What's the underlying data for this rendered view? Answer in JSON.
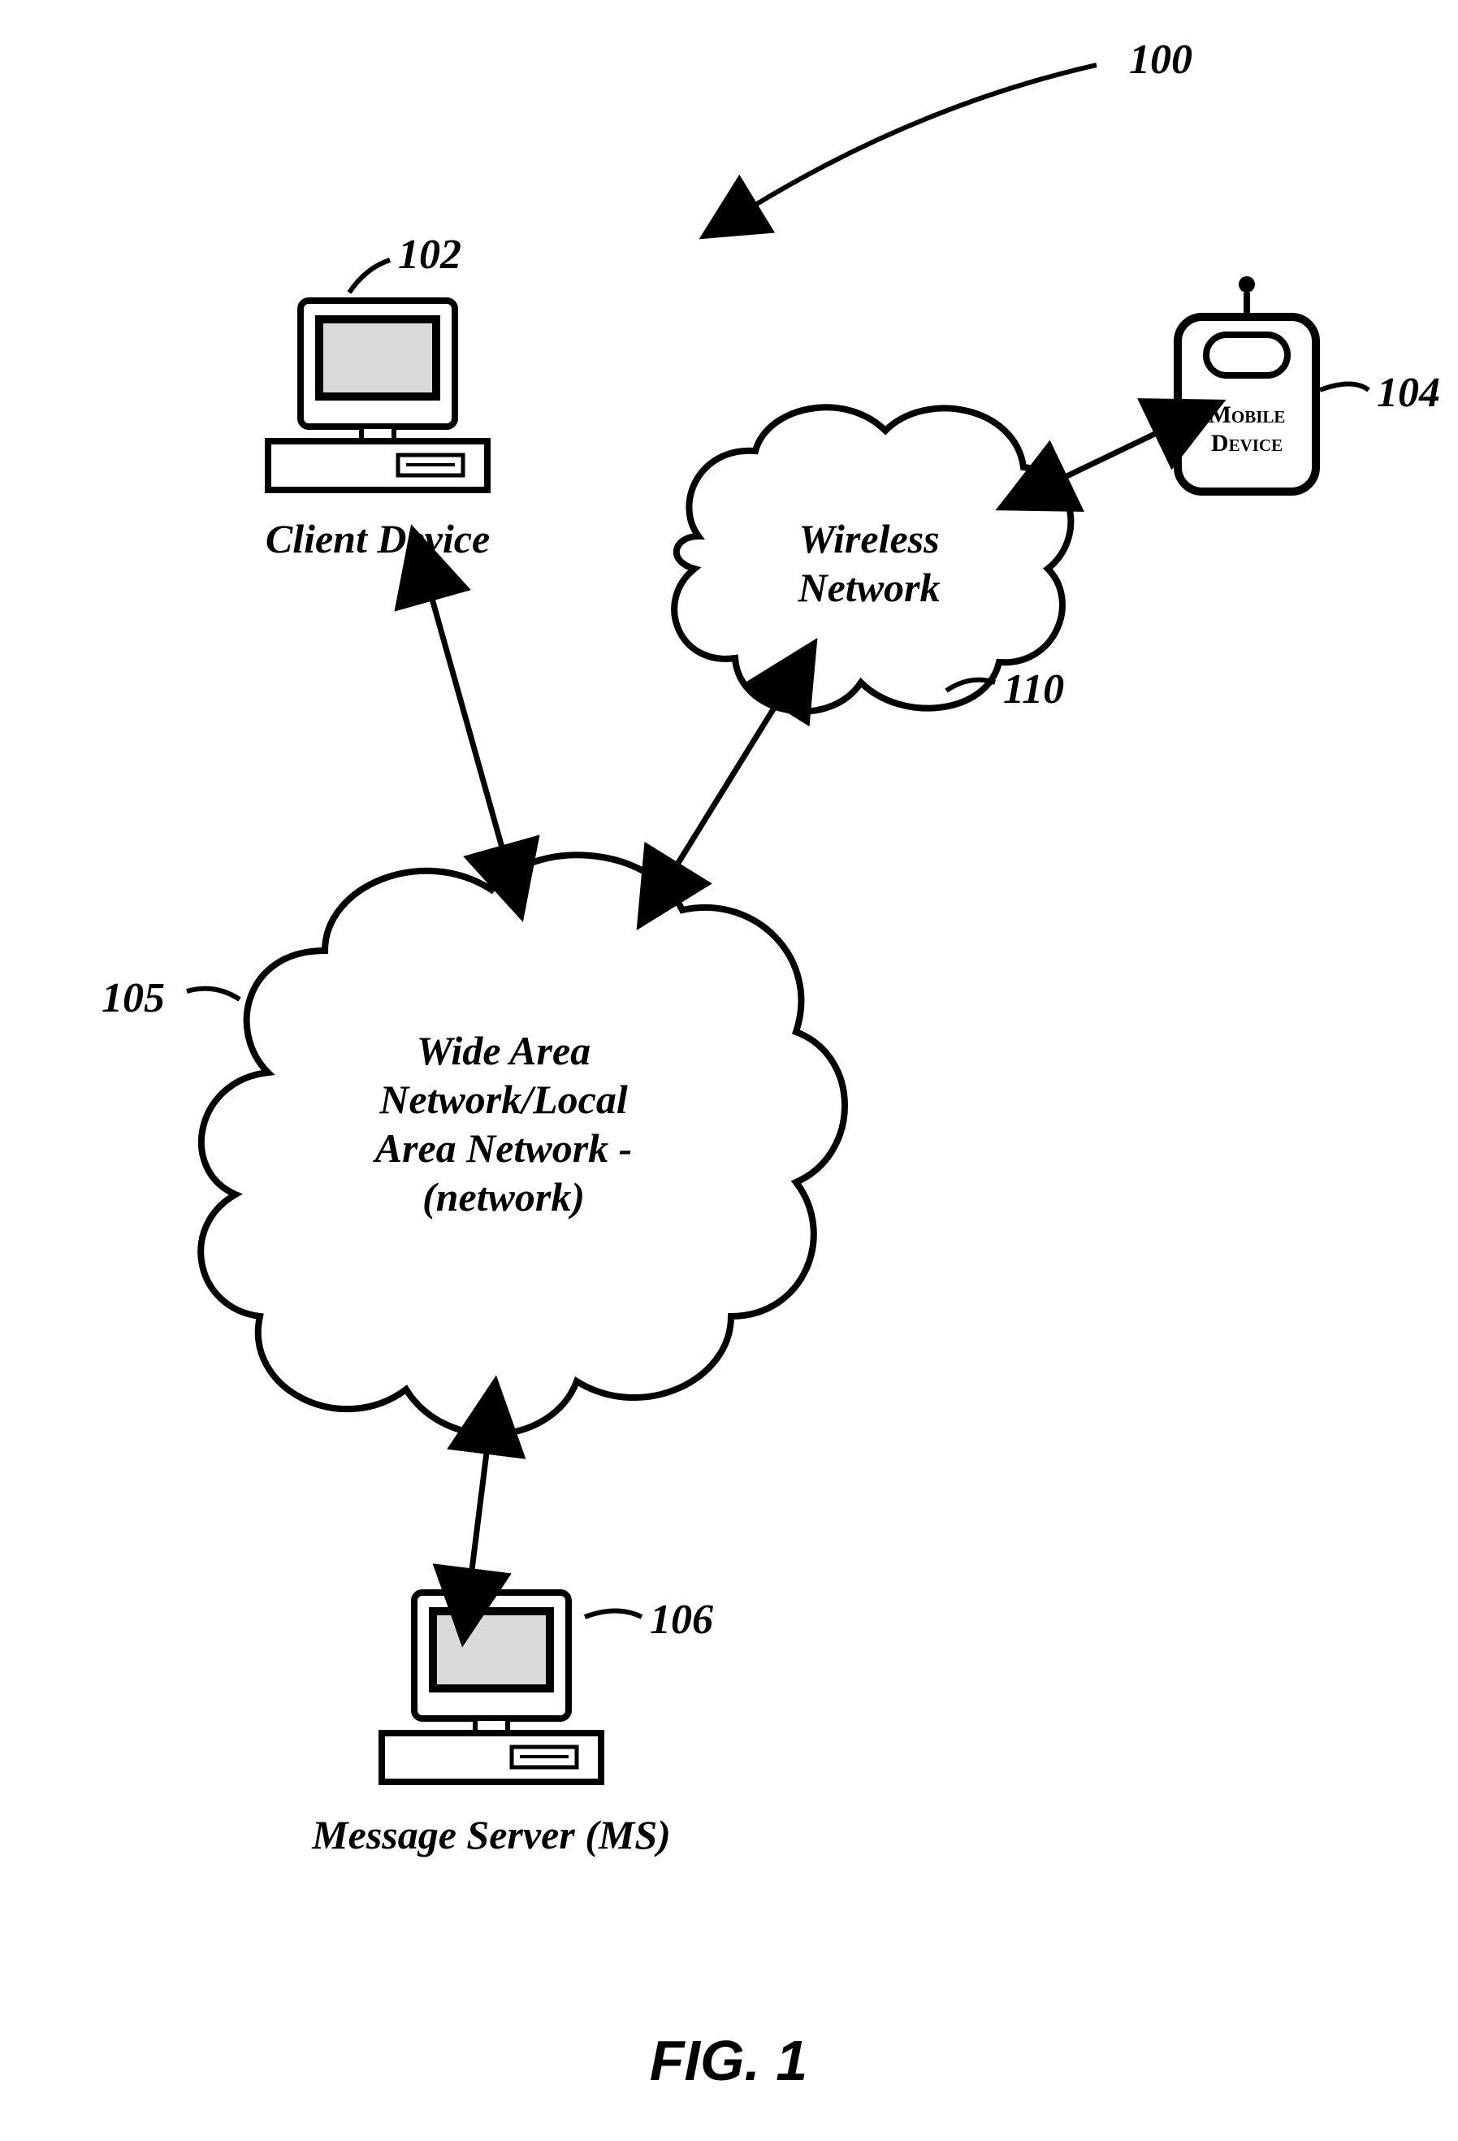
{
  "figure": {
    "title": "FIG. 1"
  },
  "refs": {
    "r100": "100",
    "r102": "102",
    "r104": "104",
    "r105": "105",
    "r106": "106",
    "r110": "110"
  },
  "nodes": {
    "client_device": {
      "label": "Client Device"
    },
    "message_server": {
      "label": "Message Server (MS)"
    },
    "wireless_network": {
      "line1": "Wireless",
      "line2": "Network"
    },
    "wan_lan": {
      "line1": "Wide Area",
      "line2": "Network/Local",
      "line3": "Area Network -",
      "line4": "(network)"
    },
    "mobile_device": {
      "line1": "Mobile",
      "line2": "Device"
    }
  }
}
